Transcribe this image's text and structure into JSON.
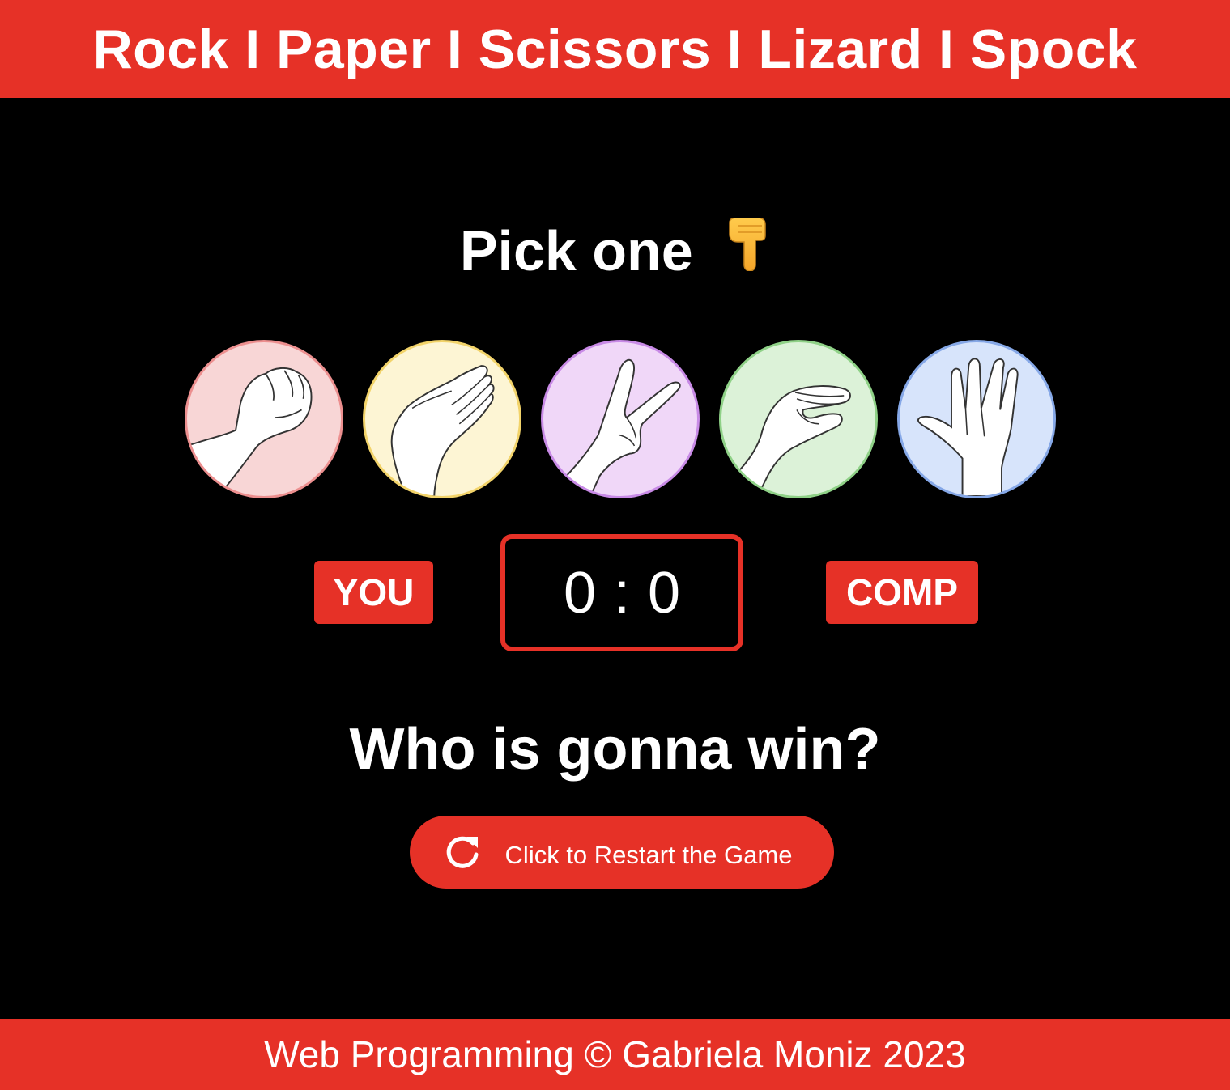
{
  "header": {
    "title": "Rock I Paper I Scissors I Lizard I Spock"
  },
  "prompt": {
    "text": "Pick one",
    "icon": "pointing-down-hand-icon"
  },
  "choices": [
    {
      "name": "rock",
      "icon": "rock-hand-icon",
      "bg": "#f8d6d6",
      "border": "#ec8f8f"
    },
    {
      "name": "paper",
      "icon": "paper-hand-icon",
      "bg": "#fdf5d4",
      "border": "#f2d36a"
    },
    {
      "name": "scissors",
      "icon": "scissors-hand-icon",
      "bg": "#f0d7f8",
      "border": "#c88ae6"
    },
    {
      "name": "lizard",
      "icon": "lizard-hand-icon",
      "bg": "#dcf2d8",
      "border": "#8fd187"
    },
    {
      "name": "spock",
      "icon": "spock-hand-icon",
      "bg": "#d7e4fb",
      "border": "#86a8e7"
    }
  ],
  "scoreboard": {
    "player_label": "YOU",
    "computer_label": "COMP",
    "player_score": "0",
    "separator": ":",
    "computer_score": "0"
  },
  "result": {
    "text": "Who is gonna win?"
  },
  "restart": {
    "label": "Click to Restart the Game",
    "icon": "restart-icon"
  },
  "footer": {
    "text": "Web Programming © Gabriela Moniz 2023"
  },
  "colors": {
    "accent": "#e63127",
    "background": "#000000",
    "text": "#ffffff"
  }
}
